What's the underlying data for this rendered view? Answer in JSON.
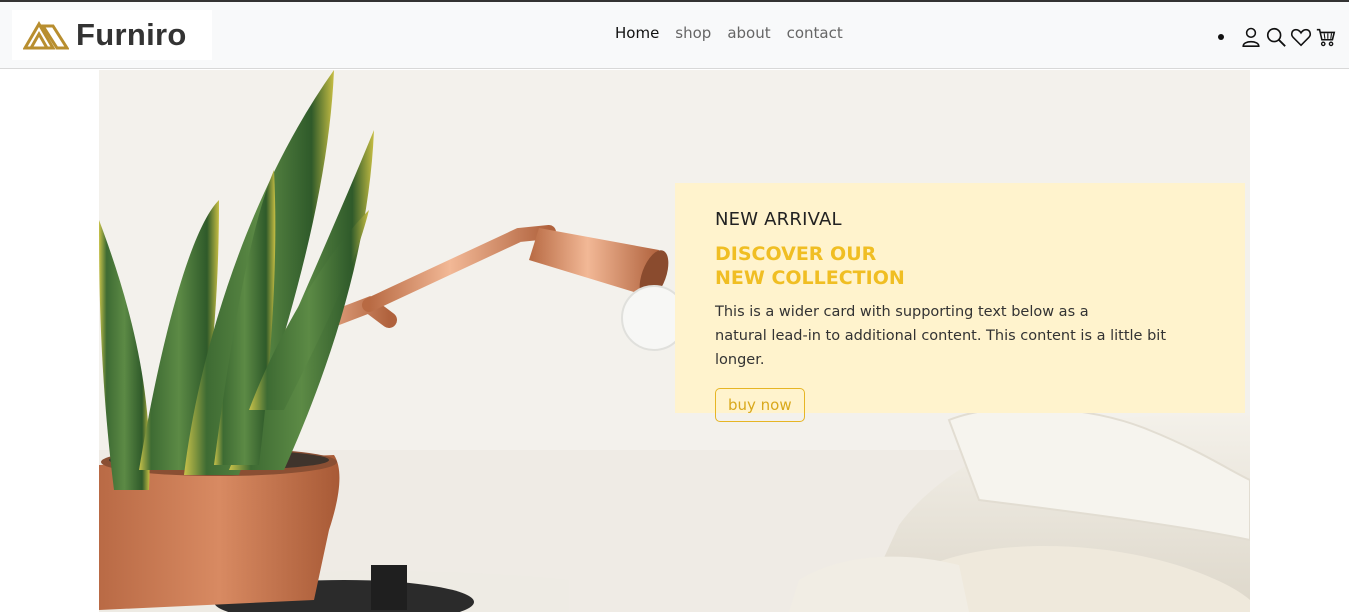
{
  "brand": {
    "name": "Furniro",
    "accent": "#b88e2f"
  },
  "nav": {
    "links": [
      {
        "label": "Home",
        "active": true
      },
      {
        "label": "shop",
        "active": false
      },
      {
        "label": "about",
        "active": false
      },
      {
        "label": "contact",
        "active": false
      }
    ],
    "icons": [
      "user-icon",
      "search-icon",
      "heart-icon",
      "cart-icon"
    ]
  },
  "hero": {
    "card": {
      "kicker": "NEW ARRIVAL",
      "title_line1": "DISCOVER OUR",
      "title_line2": "NEW COLLECTION",
      "text_line1": "This is a wider card with supporting text below as a",
      "text_line2": "natural lead-in to additional content. This content is a little bit longer.",
      "button_label": "buy now",
      "background": "#fff3cd",
      "accent": "#f0be23"
    }
  }
}
